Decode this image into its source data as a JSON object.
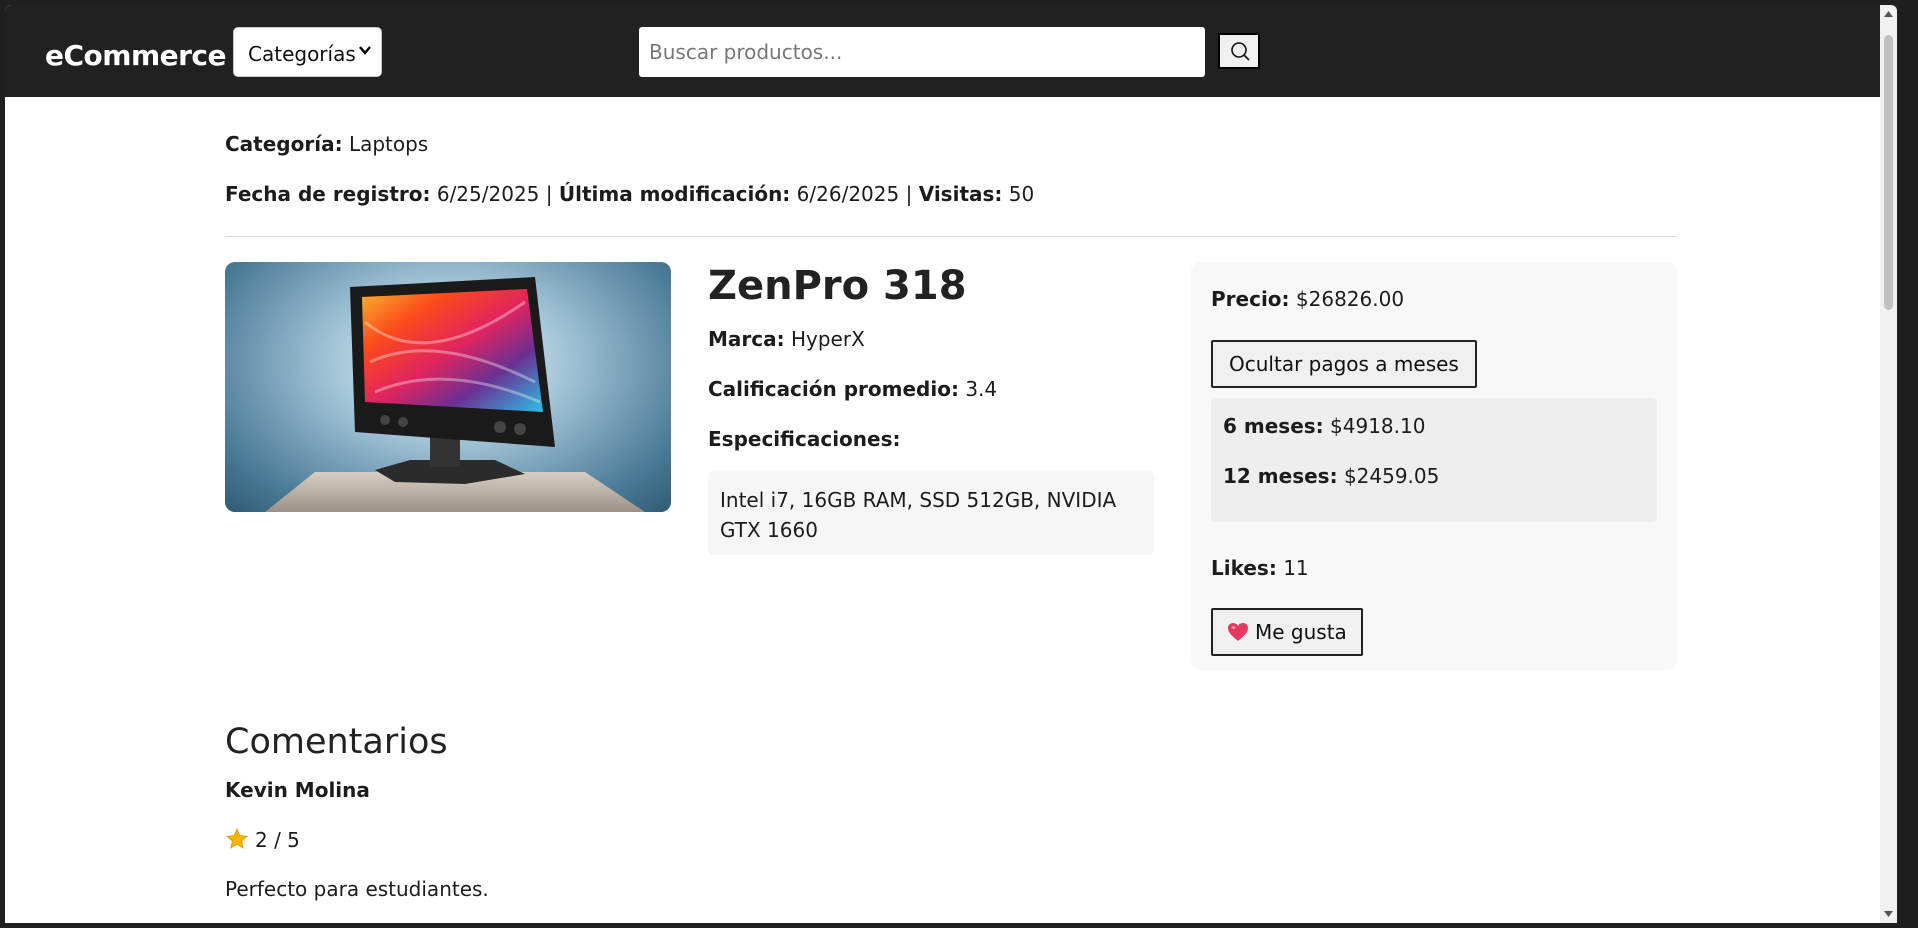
{
  "navbar": {
    "brand": "eCommerce",
    "category_select": "Categorías",
    "search_placeholder": "Buscar productos..."
  },
  "meta": {
    "category_label": "Categoría:",
    "category_value": "Laptops",
    "registered_label": "Fecha de registro:",
    "registered_value": "6/25/2025",
    "separator": "|",
    "modified_label": "Última modificación:",
    "modified_value": "6/26/2025",
    "visits_label": "Visitas:",
    "visits_value": "50"
  },
  "product": {
    "title": "ZenPro 318",
    "brand_label": "Marca:",
    "brand_value": "HyperX",
    "rating_label": "Calificación promedio:",
    "rating_value": "3.4",
    "specs_label": "Especificaciones:",
    "specs_value": "Intel i7, 16GB RAM, SSD 512GB, NVIDIA GTX 1660"
  },
  "price_panel": {
    "price_label": "Precio:",
    "price_value": "$26826.00",
    "toggle_installments_label": "Ocultar pagos a meses",
    "installments": [
      {
        "label": "6 meses:",
        "value": "$4918.10"
      },
      {
        "label": "12 meses:",
        "value": "$2459.05"
      }
    ],
    "likes_label": "Likes:",
    "likes_value": "11",
    "like_button_label": "Me gusta"
  },
  "comments": {
    "title": "Comentarios",
    "items": [
      {
        "author": "Kevin Molina",
        "rating": "2 / 5",
        "text": "Perfecto para estudiantes."
      }
    ]
  },
  "colors": {
    "navbar_bg": "#212121",
    "heart": "#e8365e",
    "star": "#f4b400"
  }
}
